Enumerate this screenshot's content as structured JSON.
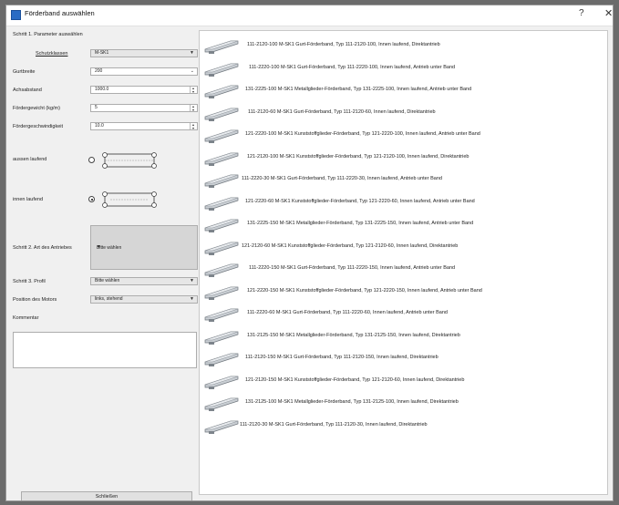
{
  "window": {
    "title": "Förderband auswählen",
    "help_glyph": "?",
    "close_glyph": "✕"
  },
  "left": {
    "step1": "Schritt 1. Parameter auswählen",
    "series_label": "Schutzklassen",
    "series_value": "M-SK1",
    "width_label": "Gurtbreite",
    "width_value": "200",
    "axis_label": "Achsabstand",
    "axis_value": "1000.0",
    "weight_label": "Fördergewicht (kg/m)",
    "weight_value": "5",
    "speed_label": "Fördergeschwindigkeit",
    "speed_value": "10.0",
    "outside_label": "aussen laufend",
    "inside_label": "innen laufend",
    "step2": "Schritt 2. Art des Antriebes",
    "drive_value": "Bitte wählen",
    "step3": "Schritt 3. Profil",
    "profile_value": "Bitte wählen",
    "motor_label": "Position des Motors",
    "motor_value": "links, stehend",
    "comment_label": "Kommentar",
    "close_button": "Schließen"
  },
  "conveyors": [
    "111-2120-100  M-SK1 Gurt-Förderband, Typ 111-2120-100, Innen laufend, Direktantrieb",
    "111-2220-100  M-SK1 Gurt-Förderband, Typ 111-2220-100, Innen laufend, Antrieb unter Band",
    "131-2225-100  M-SK1 Metallglieder-Förderband, Typ 131-2225-100, Innen laufend, Antrieb unter Band",
    "111-2120-60  M-SK1 Gurt-Förderband, Typ 111-2120-60, Innen laufend, Direktantrieb",
    "121-2220-100  M-SK1 Kunststoffglieder-Förderband, Typ 121-2220-100, Innen laufend, Antrieb unter Band",
    "121-2120-100  M-SK1 Kunststoffglieder-Förderband, Typ 121-2120-100, Innen laufend, Direktantrieb",
    "111-2220-30  M-SK1 Gurt-Förderband, Typ 111-2220-30, Innen laufend, Antrieb unter Band",
    "121-2220-60  M-SK1 Kunststoffglieder-Förderband, Typ 121-2220-60, Innen laufend, Antrieb unter Band",
    "131-2225-150  M-SK1 Metallglieder-Förderband, Typ 131-2225-150, Innen laufend, Antrieb unter Band",
    "121-2120-60  M-SK1 Kunststoffglieder-Förderband, Typ 121-2120-60, Innen laufend, Direktantrieb",
    "111-2220-150  M-SK1 Gurt-Förderband, Typ 111-2220-150, Innen laufend, Antrieb unter Band",
    "121-2220-150  M-SK1 Kunststoffglieder-Förderband, Typ 121-2220-150, Innen laufend, Antrieb unter Band",
    "111-2220-60  M-SK1 Gurt-Förderband, Typ 111-2220-60, Innen laufend, Antrieb unter Band",
    "131-2125-150  M-SK1 Metallglieder-Förderband, Typ 131-2125-150, Innen laufend, Direktantrieb",
    "111-2120-150  M-SK1 Gurt-Förderband, Typ 111-2120-150, Innen laufend, Direktantrieb",
    "121-2120-150  M-SK1 Kunststoffglieder-Förderband, Typ 121-2120-60, Innen laufend, Direktantrieb",
    "131-2125-100  M-SK1 Metallglieder-Förderband, Typ 131-2125-100, Innen laufend, Direktantrieb",
    "111-2120-30  M-SK1 Gurt-Förderband, Typ 111-2120-30, Innen laufend, Direktantrieb"
  ]
}
